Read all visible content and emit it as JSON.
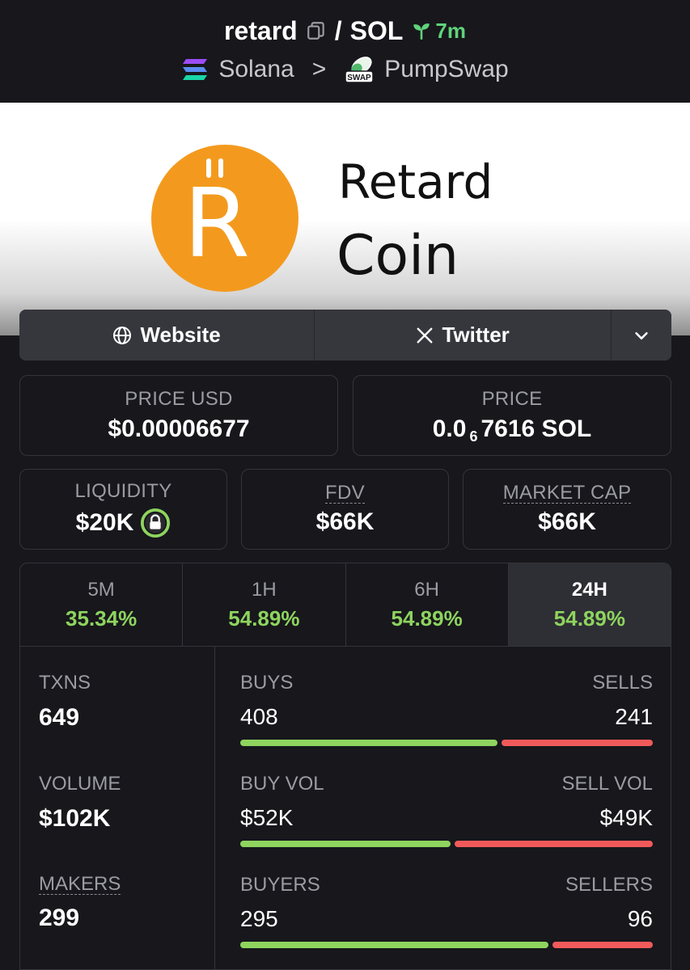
{
  "header": {
    "token_symbol": "retard",
    "separator": "/",
    "quote_symbol": "SOL",
    "age": "7m",
    "chain": "Solana",
    "breadcrumb_arrow": ">",
    "dex": "PumpSwap",
    "dex_badge": "SWAP"
  },
  "banner": {
    "logo_letter": "R",
    "text_line1": "Retard",
    "text_line2": "Coin"
  },
  "links": {
    "website": "Website",
    "twitter": "Twitter"
  },
  "price": {
    "usd_label": "PRICE USD",
    "usd_value": "$0.00006677",
    "native_label": "PRICE",
    "native_prefix": "0.0",
    "native_subscript": "6",
    "native_suffix": "7616 SOL"
  },
  "metrics": {
    "liquidity_label": "LIQUIDITY",
    "liquidity_value": "$20K",
    "fdv_label": "FDV",
    "fdv_value": "$66K",
    "mcap_label": "MARKET CAP",
    "mcap_value": "$66K"
  },
  "timeframes": [
    {
      "label": "5M",
      "change": "35.34%"
    },
    {
      "label": "1H",
      "change": "54.89%"
    },
    {
      "label": "6H",
      "change": "54.89%"
    },
    {
      "label": "24H",
      "change": "54.89%"
    }
  ],
  "stats": {
    "txns_label": "TXNS",
    "txns_value": "649",
    "volume_label": "VOLUME",
    "volume_value": "$102K",
    "makers_label": "MAKERS",
    "makers_value": "299",
    "buys_label": "BUYS",
    "buys_value": "408",
    "buys_fraction": 0.629,
    "sells_label": "SELLS",
    "sells_value": "241",
    "buyvol_label": "BUY VOL",
    "buyvol_value": "$52K",
    "buyvol_fraction": 0.515,
    "sellvol_label": "SELL VOL",
    "sellvol_value": "$49K",
    "buyers_label": "BUYERS",
    "buyers_value": "295",
    "buyers_fraction": 0.754,
    "sellers_label": "SELLERS",
    "sellers_value": "96"
  },
  "colors": {
    "buy": "#8ed45e",
    "sell": "#f15a5a",
    "age": "#5fd37a",
    "logo": "#f39a1e"
  }
}
